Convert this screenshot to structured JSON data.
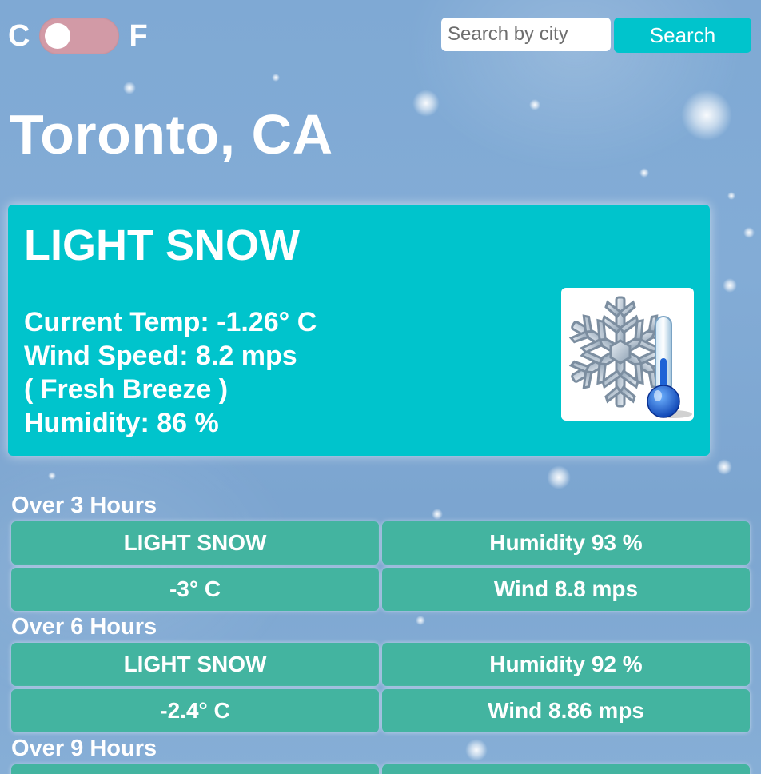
{
  "unit_toggle": {
    "celsius_label": "C",
    "fahrenheit_label": "F",
    "selected": "C"
  },
  "search": {
    "placeholder": "Search by city",
    "value": "",
    "button_label": "Search"
  },
  "city": "Toronto, CA",
  "current": {
    "description": "LIGHT SNOW",
    "temp_line": "Current Temp: -1.26° C",
    "wind_line": "Wind Speed: 8.2 mps",
    "wind_desc_line": "( Fresh Breeze )",
    "humidity_line": "Humidity: 86 %",
    "icon": "snowflake-thermometer-icon"
  },
  "forecast": [
    {
      "label": "Over 3 Hours",
      "description": "LIGHT SNOW",
      "humidity": "Humidity 93 %",
      "temp": "-3° C",
      "wind": "Wind 8.8 mps"
    },
    {
      "label": "Over 6 Hours",
      "description": "LIGHT SNOW",
      "humidity": "Humidity 92 %",
      "temp": "-2.4° C",
      "wind": "Wind 8.86 mps"
    },
    {
      "label": "Over 9 Hours"
    }
  ],
  "colors": {
    "card": "#00c4cc",
    "forecast_cell": "#43b4a0",
    "toggle_track": "#d29aa6",
    "background": "#7fa9d4"
  }
}
